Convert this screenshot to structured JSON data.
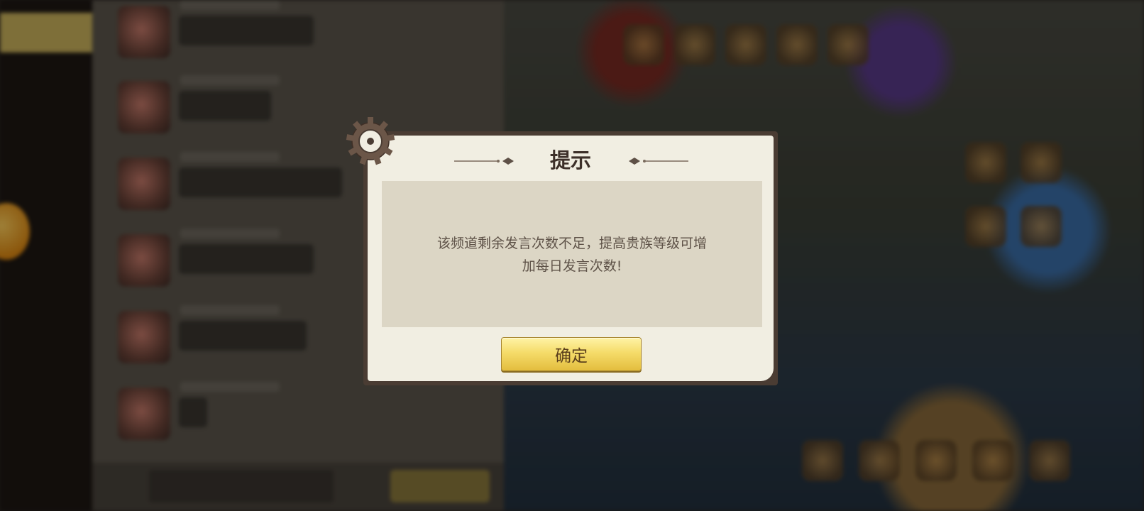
{
  "dialog": {
    "title": "提示",
    "message_line1": "该频道剩余发言次数不足，提高贵族等级可增",
    "message_line2": "加每日发言次数!",
    "confirm_label": "确定"
  },
  "colors": {
    "dialog_frame": "#4a3c33",
    "dialog_body": "#f1eee2",
    "message_box": "#dcd6c5",
    "confirm_button": "#f5dc6a"
  }
}
